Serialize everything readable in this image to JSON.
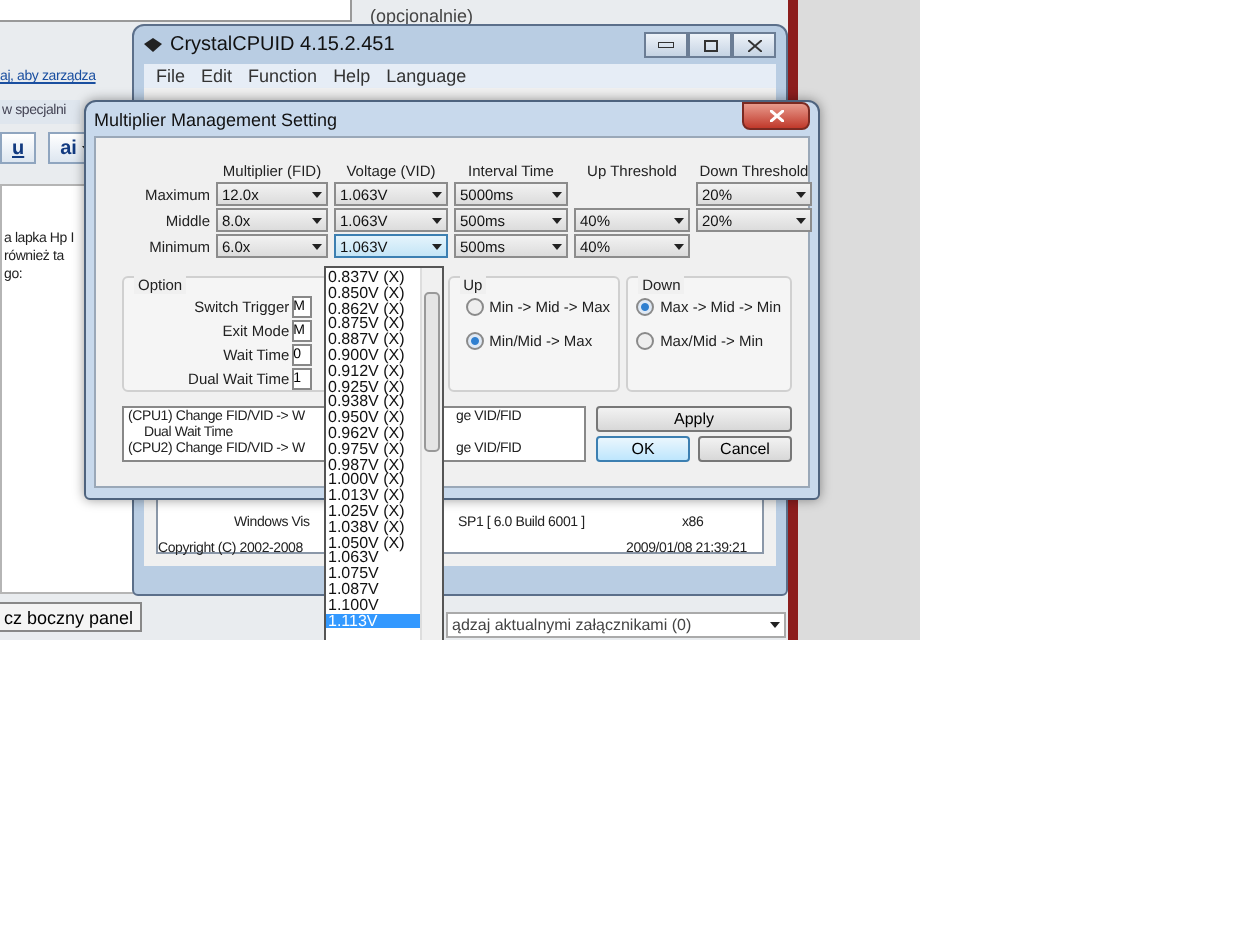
{
  "browser": {
    "top_note": "(opcjonalnie)",
    "link": "aj, aby zarządza",
    "section_label": "w specjalni",
    "toolbar": [
      "u",
      "ai"
    ],
    "body_lines": [
      "a lapka Hp I",
      "również ta",
      "go:"
    ],
    "side_panel_button": "cz boczny panel",
    "attachments": "ądzaj aktualnymi załącznikami (0)"
  },
  "crystal": {
    "title": "CrystalCPUID 4.15.2.451",
    "menu": [
      "File",
      "Edit",
      "Function",
      "Help",
      "Language"
    ],
    "os_left": "Windows Vis",
    "os_right": "SP1 [ 6.0 Build 6001 ]",
    "arch": "x86",
    "copyright": "Copyright (C) 2002-2008",
    "date": "2009/01/08 21:39:21"
  },
  "dialog": {
    "title": "Multiplier Management Setting",
    "columns": [
      "Multiplier (FID)",
      "Voltage (VID)",
      "Interval Time",
      "Up Threshold",
      "Down Threshold"
    ],
    "rows": [
      {
        "label": "Maximum",
        "cells": [
          {
            "value": "12.0x",
            "open": false
          },
          {
            "value": "1.063V",
            "open": false
          },
          {
            "value": "5000ms",
            "open": false
          },
          null,
          {
            "value": "20%",
            "open": false
          }
        ]
      },
      {
        "label": "Middle",
        "cells": [
          {
            "value": "8.0x",
            "open": false
          },
          {
            "value": "1.063V",
            "open": false
          },
          {
            "value": "500ms",
            "open": false
          },
          {
            "value": "40%",
            "open": false
          },
          {
            "value": "20%",
            "open": false
          }
        ]
      },
      {
        "label": "Minimum",
        "cells": [
          {
            "value": "6.0x",
            "open": false
          },
          {
            "value": "1.063V",
            "open": true
          },
          {
            "value": "500ms",
            "open": false
          },
          {
            "value": "40%",
            "open": false
          },
          null
        ]
      }
    ],
    "option": {
      "title": "Option",
      "fields": [
        {
          "label": "Switch Trigger",
          "value": "M"
        },
        {
          "label": "Exit Mode",
          "value": "M"
        },
        {
          "label": "Wait Time",
          "value": "0"
        },
        {
          "label": "Dual Wait Time",
          "value": "1"
        }
      ]
    },
    "up": {
      "title": "Up",
      "options": [
        {
          "label": "Min -> Mid -> Max",
          "selected": false
        },
        {
          "label": "Min/Mid -> Max",
          "selected": true
        }
      ]
    },
    "down": {
      "title": "Down",
      "options": [
        {
          "label": "Max -> Mid -> Min",
          "selected": true
        },
        {
          "label": "Max/Mid -> Min",
          "selected": false
        }
      ]
    },
    "log": [
      {
        "left": "(CPU1) Change FID/VID -> W",
        "right": "ge VID/FID"
      },
      {
        "left": "Dual Wait Time"
      },
      {
        "left": "(CPU2) Change FID/VID -> W",
        "right": "ge VID/FID"
      }
    ],
    "buttons": {
      "apply": "Apply",
      "ok": "OK",
      "cancel": "Cancel"
    }
  },
  "dropdown": [
    {
      "label": "0.837V (X)",
      "selected": false
    },
    {
      "label": "0.850V (X)",
      "selected": false
    },
    {
      "label": "0.862V (X)",
      "selected": false
    },
    {
      "label": "0.875V (X)",
      "selected": false
    },
    {
      "label": "0.887V (X)",
      "selected": false
    },
    {
      "label": "0.900V (X)",
      "selected": false
    },
    {
      "label": "0.912V (X)",
      "selected": false
    },
    {
      "label": "0.925V (X)",
      "selected": false
    },
    {
      "label": "0.938V (X)",
      "selected": false
    },
    {
      "label": "0.950V (X)",
      "selected": false
    },
    {
      "label": "0.962V (X)",
      "selected": false
    },
    {
      "label": "0.975V (X)",
      "selected": false
    },
    {
      "label": "0.987V (X)",
      "selected": false
    },
    {
      "label": "1.000V (X)",
      "selected": false
    },
    {
      "label": "1.013V (X)",
      "selected": false
    },
    {
      "label": "1.025V (X)",
      "selected": false
    },
    {
      "label": "1.038V (X)",
      "selected": false
    },
    {
      "label": "1.050V (X)",
      "selected": false
    },
    {
      "label": "1.063V",
      "selected": false
    },
    {
      "label": "1.075V",
      "selected": false
    },
    {
      "label": "1.087V",
      "selected": false
    },
    {
      "label": "1.100V",
      "selected": false
    },
    {
      "label": "1.113V",
      "selected": true
    }
  ]
}
